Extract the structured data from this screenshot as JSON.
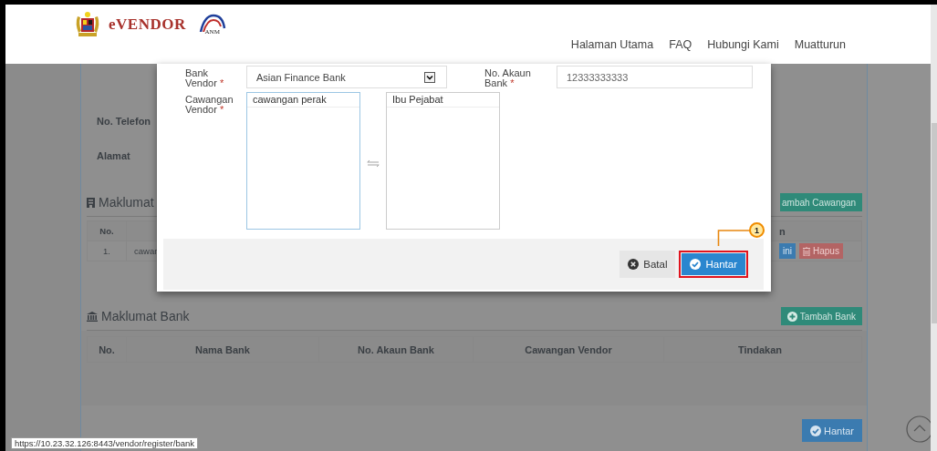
{
  "header": {
    "logo_text": "eVENDOR",
    "logo_badge": "ANM",
    "nav": [
      "Halaman Utama",
      "FAQ",
      "Hubungi Kami",
      "Muatturun"
    ]
  },
  "background_page": {
    "fields": [
      "No. Telefon",
      "Alamat"
    ],
    "branch_section": {
      "title": "Maklumat",
      "button": "ambah Cawangan",
      "columns": [
        "No.",
        "n"
      ],
      "rows": [
        {
          "cells": [
            "1.",
            "cawan"
          ],
          "actions": [
            {
              "label": "ini",
              "kind": "edit"
            },
            {
              "label": "Hapus",
              "kind": "delete"
            }
          ]
        }
      ]
    },
    "bank_section": {
      "title": "Maklumat Bank",
      "button": "Tambah Bank",
      "columns": [
        "No.",
        "Nama Bank",
        "No. Akaun Bank",
        "Cawangan Vendor",
        "Tindakan"
      ]
    },
    "submit_button": "Hantar"
  },
  "modal": {
    "fields": [
      {
        "label": "Bank Vendor",
        "mark": "*",
        "kind": "select",
        "value": "Asian Finance Bank"
      },
      {
        "label": "No. Akaun Bank",
        "mark": "*",
        "kind": "input",
        "value": "12333333333"
      }
    ],
    "branch": {
      "label": "Cawangan Vendor",
      "mark": "*",
      "available": [
        "cawangan perak"
      ],
      "chosen": [
        "Ibu Pejabat"
      ]
    },
    "buttons": [
      {
        "label": "Batal",
        "kind": "cancel",
        "highlighted": false
      },
      {
        "label": "Hantar",
        "kind": "submit",
        "highlighted": true
      }
    ],
    "callout": "1"
  },
  "status_url": "https://10.23.32.126:8443/vendor/register/bank"
}
